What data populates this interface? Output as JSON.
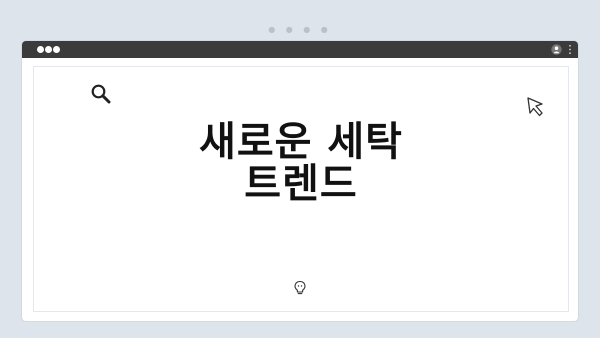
{
  "top_dots": "● ● ● ●",
  "headline": {
    "line1": "새로운 세탁",
    "line2": "트렌드"
  },
  "icons": {
    "window_controls": "traffic-light-dots",
    "user": "user-icon",
    "menu": "kebab-icon",
    "search": "search-icon",
    "cursor": "cursor-icon",
    "bulb": "lightbulb-icon"
  },
  "colors": {
    "background": "#dde4ec",
    "titlebar": "#3b3b3b",
    "window": "#ffffff",
    "text": "#111111"
  }
}
